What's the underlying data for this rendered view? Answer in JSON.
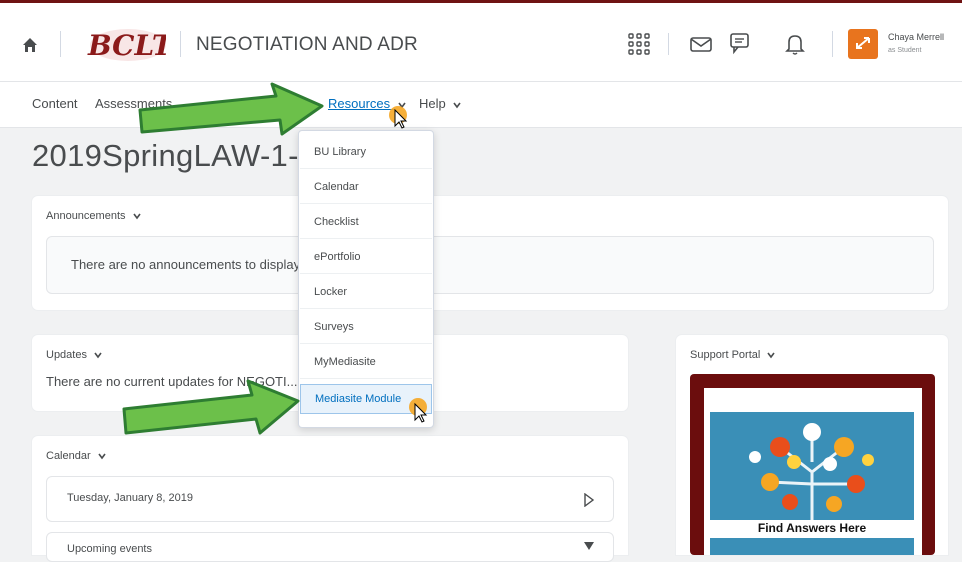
{
  "header": {
    "logo_text": "BCLT",
    "course_title": "NEGOTIATION AND ADR",
    "user_name": "Chaya Merrell",
    "user_role": "as Student",
    "icons": [
      "home-icon",
      "waffle-icon",
      "mail-icon",
      "chat-icon",
      "bell-icon"
    ]
  },
  "nav": {
    "items": [
      {
        "label": "Content"
      },
      {
        "label": "Assessments"
      },
      {
        "label": "Resources"
      },
      {
        "label": "Help"
      }
    ]
  },
  "page": {
    "title": "2019SpringLAW-1-47"
  },
  "announcements": {
    "title": "Announcements",
    "message": "There are no announcements to display"
  },
  "updates": {
    "title": "Updates",
    "message": "There are no current updates for NEGOTI..."
  },
  "calendar": {
    "title": "Calendar",
    "date": "Tuesday, January 8, 2019",
    "upcoming": "Upcoming events"
  },
  "support": {
    "title": "Support Portal",
    "banner_text": "Find Answers Here"
  },
  "resources_menu": {
    "items": [
      {
        "label": "BU Library"
      },
      {
        "label": "Calendar"
      },
      {
        "label": "Checklist"
      },
      {
        "label": "ePortfolio"
      },
      {
        "label": "Locker"
      },
      {
        "label": "Surveys"
      },
      {
        "label": "MyMediasite"
      },
      {
        "label": "Mediasite Module"
      }
    ],
    "highlighted": "Mediasite Module"
  },
  "colors": {
    "brand_bar": "#6f1313",
    "link": "#006fbf",
    "arrow_fill": "#6cc04a",
    "arrow_stroke": "#2e7d32",
    "cursor_dot": "#f5a623",
    "avatar": "#e8741e"
  }
}
